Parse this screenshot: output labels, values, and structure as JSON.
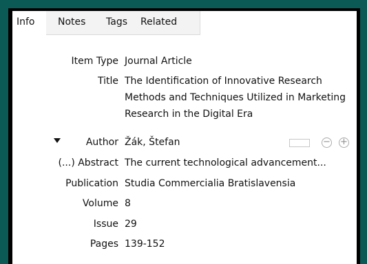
{
  "tabs": [
    {
      "label": "Info"
    },
    {
      "label": "Notes"
    },
    {
      "label": "Tags"
    },
    {
      "label": "Related"
    }
  ],
  "fields": {
    "item_type": {
      "label": "Item Type",
      "value": "Journal Article"
    },
    "title": {
      "label": "Title",
      "value": "The Identification of Innovative Research Methods and Techniques Utilized in Marketing Research in the Digital Era"
    },
    "author": {
      "label": "Author",
      "value": "Žák, Štefan",
      "toggle_icon": "triangle-down-icon",
      "minus_icon": "minus-circle-icon",
      "plus_icon": "plus-circle-icon",
      "minus_glyph": "−",
      "plus_glyph": "+"
    },
    "abstract": {
      "label": "(...) Abstract",
      "value": "The current technological advancement..."
    },
    "publication": {
      "label": "Publication",
      "value": "Studia Commercialia Bratislavensia"
    },
    "volume": {
      "label": "Volume",
      "value": "8"
    },
    "issue": {
      "label": "Issue",
      "value": "29"
    },
    "pages": {
      "label": "Pages",
      "value": "139-152"
    }
  },
  "colors": {
    "background": "#0b5a55",
    "panel": "#ffffff",
    "frame": "#000000",
    "tab_strip": "#f3f3f3",
    "text": "#111111"
  }
}
